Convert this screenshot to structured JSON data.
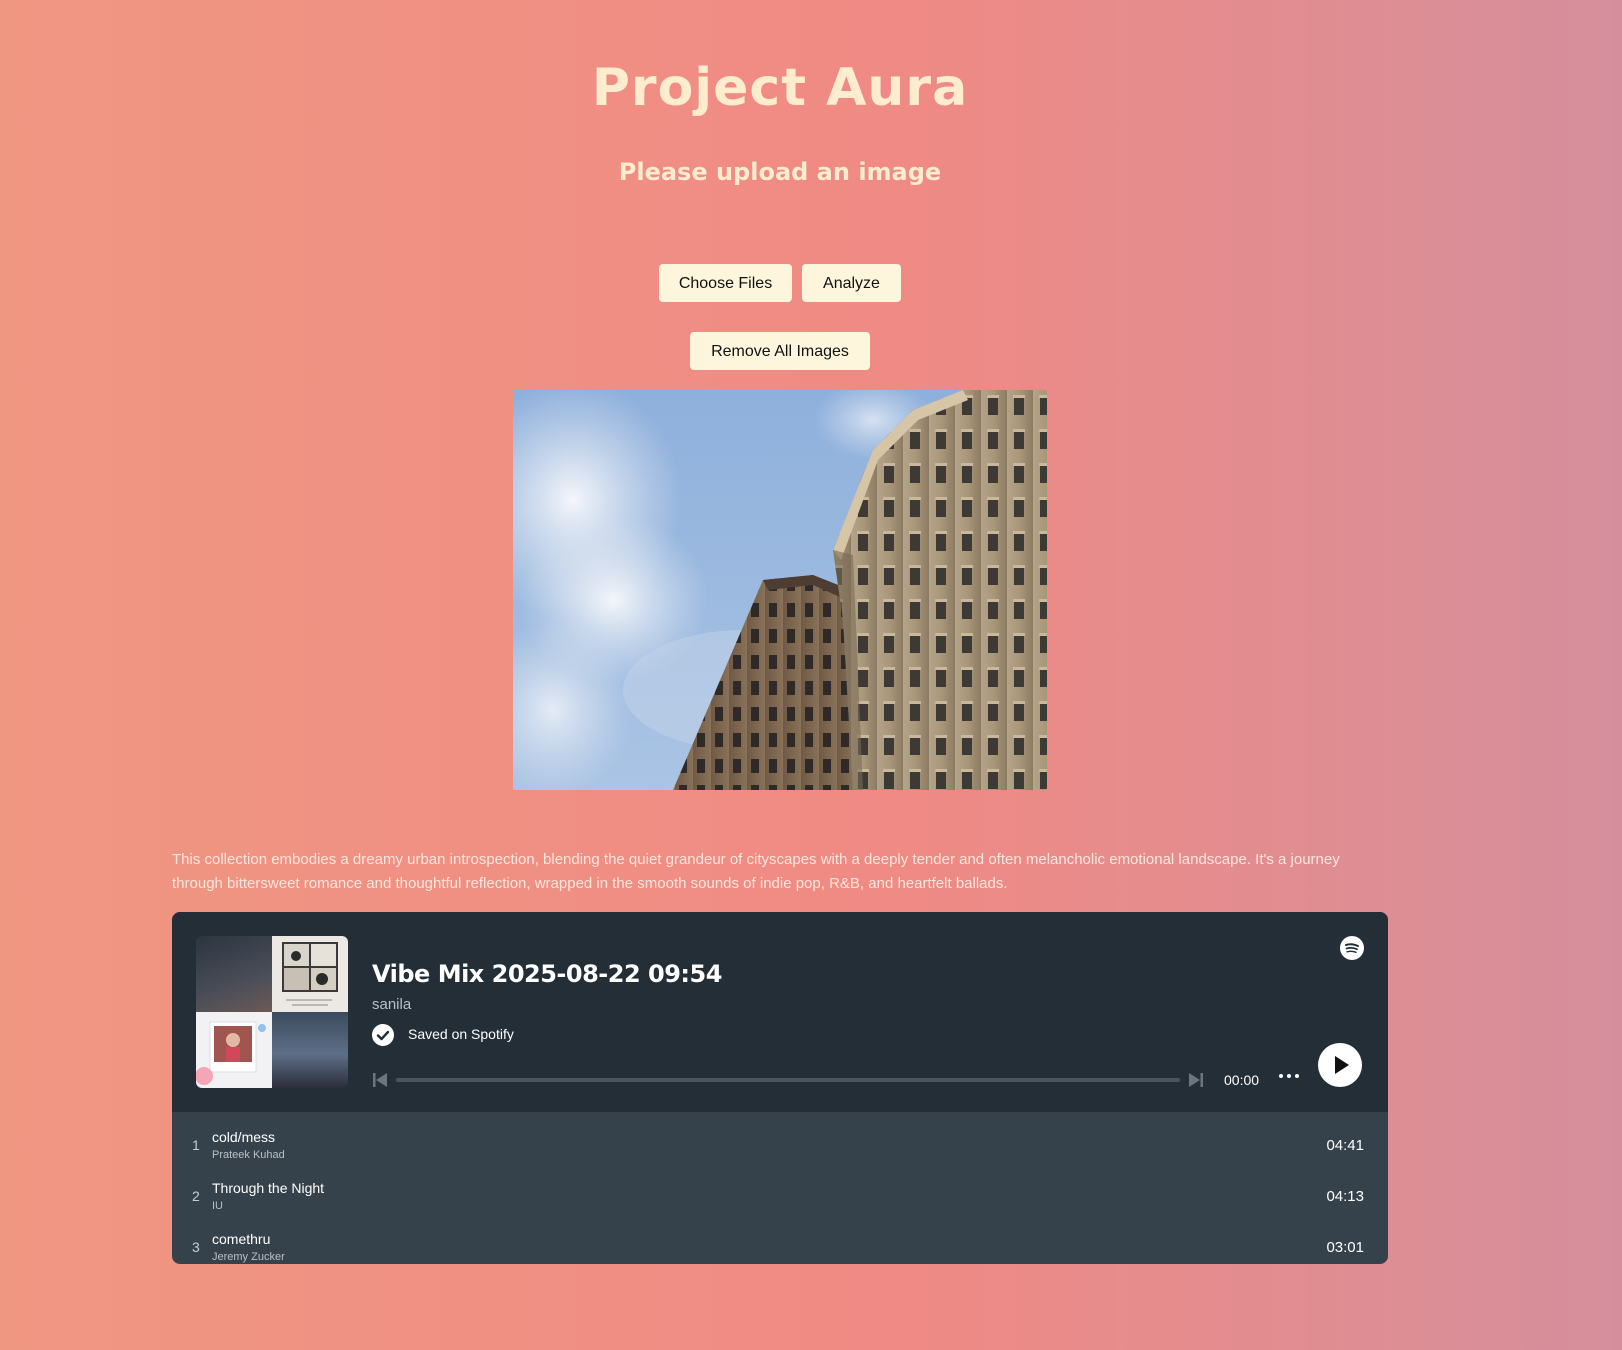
{
  "header": {
    "title": "Project Aura",
    "subtitle": "Please upload an image"
  },
  "controls": {
    "choose_files": "Choose Files",
    "analyze": "Analyze",
    "remove_all": "Remove All Images"
  },
  "uploaded_image": {
    "icon": "city-buildings-sky-photo"
  },
  "description": "This collection embodies a dreamy urban introspection, blending the quiet grandeur of cityscapes with a deeply tender and often melancholic emotional landscape. It's a journey through bittersweet romance and thoughtful reflection, wrapped in the smooth sounds of indie pop, R&B, and heartfelt ballads.",
  "player": {
    "playlist_title": "Vibe Mix 2025-08-22 09:54",
    "owner": "sanila",
    "saved_label": "Saved on Spotify",
    "time": "00:00",
    "progress": 0,
    "colors": {
      "header_bg": "#232e37",
      "list_bg": "#36424b"
    },
    "tracks": [
      {
        "num": "1",
        "name": "cold/mess",
        "artist": "Prateek Kuhad",
        "duration": "04:41"
      },
      {
        "num": "2",
        "name": "Through the Night",
        "artist": "IU",
        "duration": "04:13"
      },
      {
        "num": "3",
        "name": "comethru",
        "artist": "Jeremy Zucker",
        "duration": "03:01"
      }
    ]
  },
  "colors": {
    "title": "#fdeccd",
    "button_bg": "#fdf6dc",
    "background_start": "#f09782",
    "background_end": "#d58f9c"
  }
}
